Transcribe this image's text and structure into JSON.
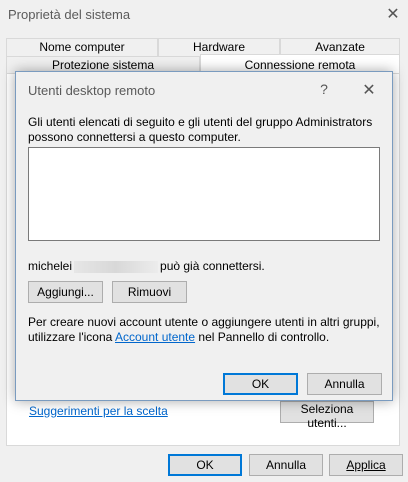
{
  "window": {
    "title": "Proprietà del sistema",
    "tabs_top": [
      "Nome computer",
      "Hardware",
      "Avanzate"
    ],
    "tabs_bottom": [
      "Protezione sistema",
      "Connessione remota"
    ],
    "suggestion_link": "Suggerimenti per la scelta",
    "select_users_button": "Seleziona utenti...",
    "ok": "OK",
    "cancel": "Annulla",
    "apply": "Applica"
  },
  "dialog": {
    "title": "Utenti desktop remoto",
    "help": "?",
    "description": "Gli utenti elencati di seguito e gli utenti del gruppo Administrators possono connettersi a questo computer.",
    "user_prefix": "michelei",
    "user_suffix": "può già connettersi.",
    "add_button": "Aggiungi...",
    "remove_button": "Rimuovi",
    "info_part1": "Per creare nuovi account utente o aggiungere utenti in altri gruppi, utilizzare l'icona",
    "info_link": "Account utente",
    "info_part2": "nel Pannello di controllo.",
    "ok": "OK",
    "cancel": "Annulla"
  }
}
